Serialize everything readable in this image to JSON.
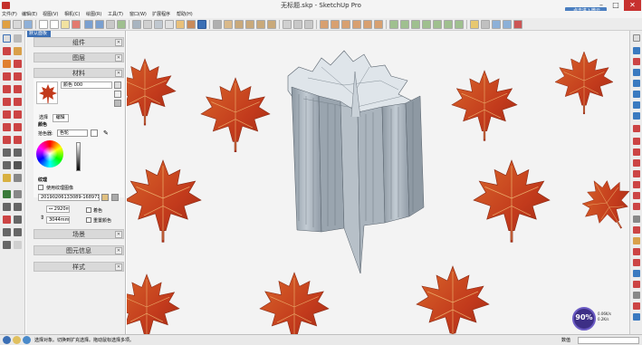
{
  "window": {
    "title": "无标题.skp - SketchUp Pro",
    "minimize_glyph": "–",
    "maximize_glyph": "□",
    "close_glyph": "✕",
    "cloud_label": "点击进入微云"
  },
  "menu": [
    "文件(F)",
    "编辑(E)",
    "视图(V)",
    "相机(C)",
    "绘图(R)",
    "工具(T)",
    "窗口(W)",
    "扩展程序",
    "帮助(H)"
  ],
  "tray": {
    "tab_label": "默认面板",
    "panels": {
      "components": "组件",
      "layers": "图层",
      "materials": "材料",
      "scenes": "场景",
      "entity_info": "图元信息",
      "styles": "样式"
    },
    "materials": {
      "name": "颜色 000",
      "tab_select": "选择",
      "tab_edit": "编辑",
      "section_color": "颜色",
      "picker_label": "拾色器:",
      "picker_value": "色轮",
      "section_texture": "纹理",
      "use_texture_label": "使用纹理图像",
      "texture_file": "20190206133089-1689714290",
      "width_value": "↔ 2920mm",
      "height_value": "3044mm",
      "colorize_label": "着色",
      "reset_color_label": "重置颜色"
    }
  },
  "status": {
    "hint": "选择对象。切换到扩充选择。拖动鼠标选择多项。",
    "measurement_label": "数值"
  },
  "perf": {
    "percent": "90%",
    "up": "0.06K/s",
    "down": "0.2K/s"
  },
  "colors": {
    "accent": "#3b6fb5",
    "leaf_red": "#c23a1c",
    "leaf_orange": "#d9662a",
    "model_gray": "#a6b1bb"
  }
}
